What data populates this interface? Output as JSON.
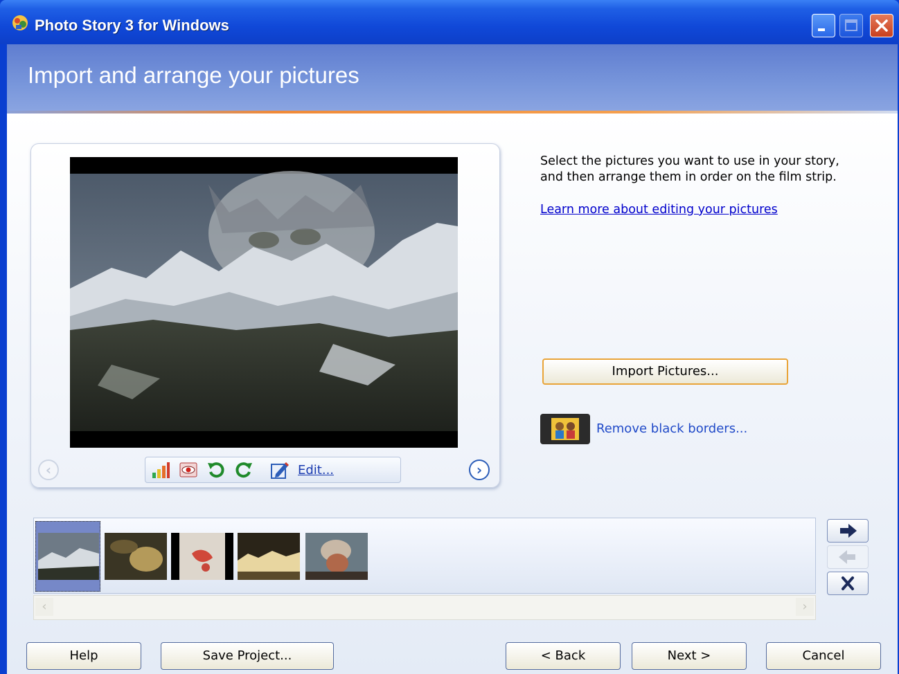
{
  "window": {
    "title": "Photo Story 3 for Windows",
    "icon": "photo-story-app-icon"
  },
  "titlebar_buttons": {
    "minimize_icon": "minimize-icon",
    "maximize_icon": "maximize-icon",
    "close_icon": "close-icon"
  },
  "header": {
    "title": "Import and arrange your pictures"
  },
  "viewer": {
    "tools": [
      "auto-correct-icon",
      "red-eye-icon",
      "rotate-left-icon",
      "rotate-right-icon",
      "edit-icon"
    ],
    "edit_label": "Edit..."
  },
  "right_panel": {
    "instruction": "Select the pictures you want to use in your story, and then arrange them in order on the film strip.",
    "learn_more_link": "Learn more about editing your pictures",
    "import_button": "Import Pictures...",
    "remove_borders_link": "Remove black borders..."
  },
  "filmstrip": {
    "selected_index": 0,
    "thumbnails": [
      "snow-leopard-mountains",
      "rock-detail",
      "red-paint-on-rock",
      "ruins-landscape",
      "traveler-portrait"
    ]
  },
  "side_buttons": {
    "move_right_icon": "arrow-right-icon",
    "move_left_icon": "arrow-left-icon",
    "delete_icon": "x-icon"
  },
  "footer": {
    "help": "Help",
    "save_project": "Save Project...",
    "back": "< Back",
    "next": "Next >",
    "cancel": "Cancel"
  },
  "colors": {
    "titlebar": "#1048d8",
    "header": "#7896db",
    "accent_orange": "#f08a38",
    "link": "#0000cc"
  }
}
